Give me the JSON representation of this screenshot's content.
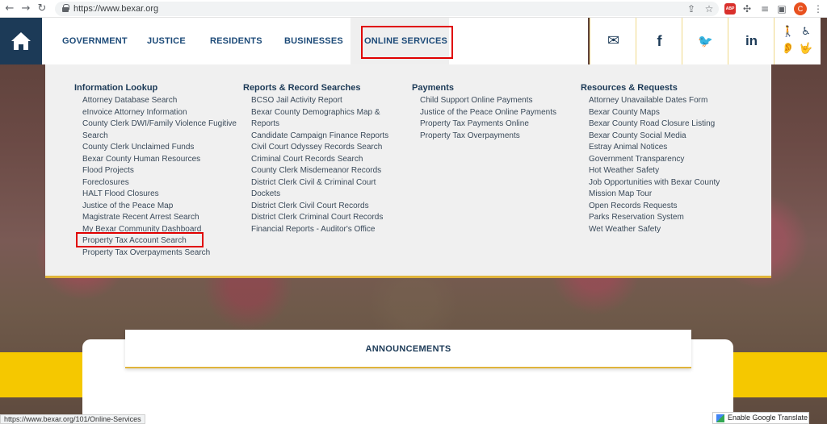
{
  "browser": {
    "url": "https://www.bexar.org",
    "back_glyph": "←",
    "forward_glyph": "→",
    "reload_glyph": "↻",
    "share_glyph": "⇪",
    "star_glyph": "☆",
    "abp_label": "ABP",
    "puzzle_glyph": "✣",
    "playlist_glyph": "≡",
    "sidebar_glyph": "▣",
    "avatar_letter": "C",
    "menu_glyph": "⋮"
  },
  "nav": {
    "items": [
      {
        "label": "GOVERNMENT"
      },
      {
        "label": "JUSTICE"
      },
      {
        "label": "RESIDENTS"
      },
      {
        "label": "BUSINESSES"
      },
      {
        "label": "ONLINE SERVICES"
      }
    ]
  },
  "social": {
    "mail_glyph": "✉",
    "facebook_glyph": "f",
    "twitter_glyph": "🐦",
    "linkedin_glyph": "in"
  },
  "accessibility": {
    "walk_glyph": "🚶",
    "wheelchair_glyph": "♿",
    "ear_glyph": "👂",
    "sign_glyph": "🤟"
  },
  "menu": {
    "columns": [
      {
        "heading": "Information Lookup",
        "items": [
          "Attorney Database Search",
          "eInvoice Attorney Information",
          "County Clerk DWI/Family Violence Fugitive Search",
          "County Clerk Unclaimed Funds",
          "Bexar County Human Resources",
          "Flood Projects",
          "Foreclosures",
          "HALT Flood Closures",
          "Justice of the Peace Map",
          "Magistrate Recent Arrest Search",
          "My Bexar Community Dashboard",
          "Property Tax Account Search",
          "Property Tax Overpayments Search"
        ]
      },
      {
        "heading": "Reports & Record Searches",
        "items": [
          "BCSO Jail Activity Report",
          "Bexar County Demographics Map & Reports",
          "Candidate Campaign Finance Reports",
          "Civil Court Odyssey Records Search",
          "Criminal Court Records Search",
          "County Clerk Misdemeanor Records",
          "District Clerk Civil & Criminal Court Dockets",
          "District Clerk Civil Court Records",
          "District Clerk Criminal Court Records",
          "Financial Reports - Auditor's Office"
        ]
      },
      {
        "heading": "Payments",
        "items": [
          "Child Support Online Payments",
          "Justice of the Peace Online Payments",
          "Property Tax Payments Online",
          "Property Tax Overpayments"
        ]
      },
      {
        "heading": "Resources & Requests",
        "items": [
          "Attorney Unavailable Dates Form",
          "Bexar County Maps",
          "Bexar County Road Closure Listing",
          "Bexar County Social Media",
          "Estray Animal Notices",
          "Government Transparency",
          "Hot Weather Safety",
          "Job Opportunities with Bexar County",
          "Mission Map Tour",
          "Open Records Requests",
          "Parks Reservation System",
          "Wet Weather Safety"
        ]
      }
    ]
  },
  "announcements": {
    "title": "ANNOUNCEMENTS"
  },
  "status_url": "https://www.bexar.org/101/Online-Services",
  "translate": {
    "label": "Enable Google Translate"
  },
  "colors": {
    "navy": "#1c3a57",
    "link": "#1c4a78",
    "gold": "#e0b43a",
    "yellow": "#f5c800",
    "highlight": "#e00000"
  }
}
